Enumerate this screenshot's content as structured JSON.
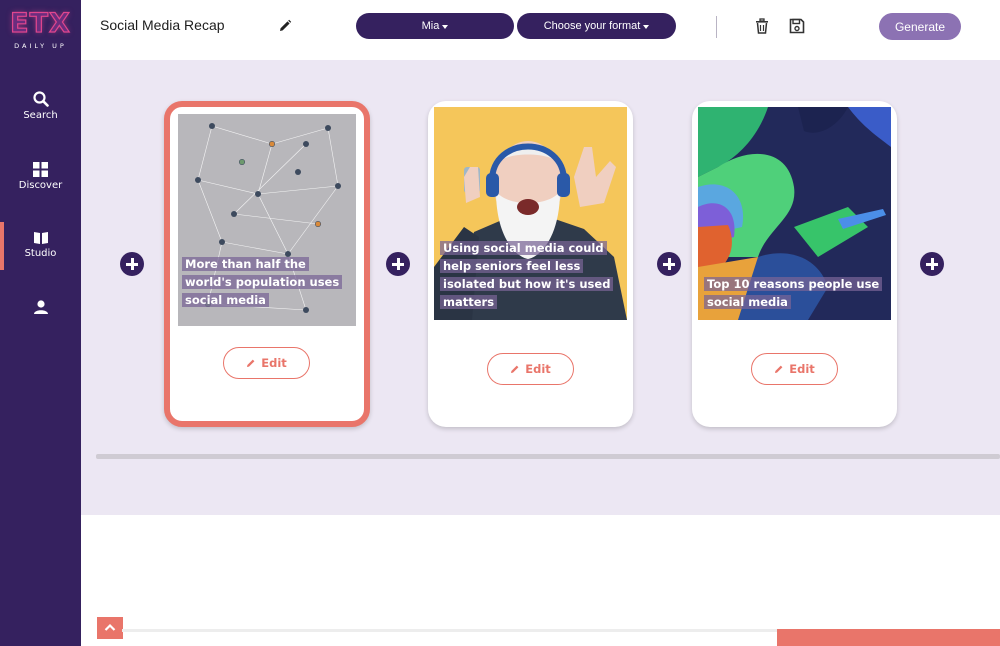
{
  "brand": {
    "logo_text": "ETX",
    "tagline": "DAILY UP"
  },
  "sidebar": {
    "items": [
      {
        "label": "Search",
        "icon": "search-icon"
      },
      {
        "label": "Discover",
        "icon": "grid-icon"
      },
      {
        "label": "Studio",
        "icon": "book-icon",
        "active": true
      },
      {
        "label": "",
        "icon": "user-icon"
      }
    ]
  },
  "header": {
    "title": "Social Media Recap",
    "voice_select": "Mia",
    "format_select": "Choose your format",
    "generate_label": "Generate"
  },
  "cards": [
    {
      "caption": "More than half the world's population uses social media",
      "edit_label": "Edit",
      "selected": true
    },
    {
      "caption": "Using social media could help seniors feel less isolated but how it's used matters",
      "edit_label": "Edit",
      "selected": false
    },
    {
      "caption": "Top 10 reasons people use social media",
      "edit_label": "Edit",
      "selected": false
    }
  ],
  "colors": {
    "primary": "#35215f",
    "accent": "#e9756a",
    "generate": "#8c72b3",
    "workspace_bg": "#ece7f3"
  }
}
